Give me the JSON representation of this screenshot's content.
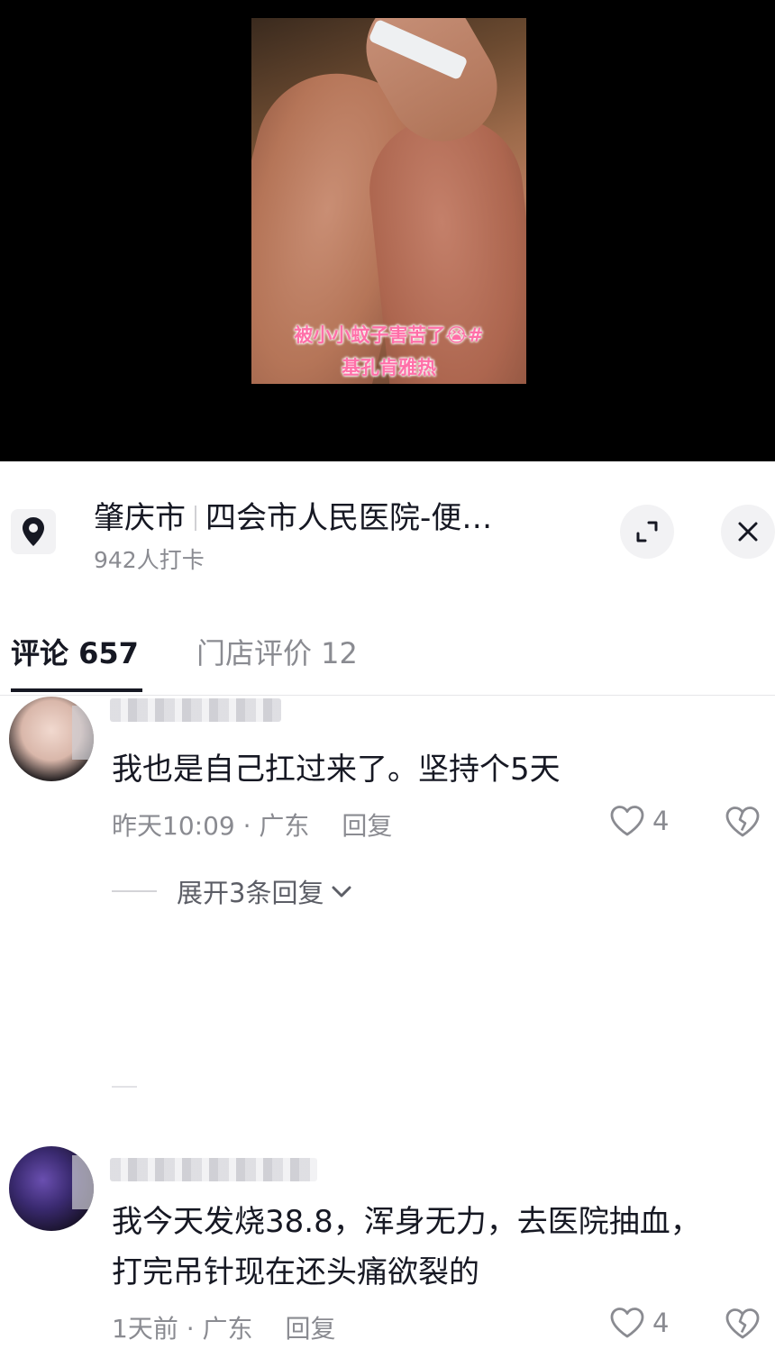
{
  "video": {
    "caption_line1": "被小小蚊子害苦了😭#",
    "caption_line2": "基孔肯雅热"
  },
  "location": {
    "city": "肇庆市",
    "place": "四会市人民医院-便…",
    "checkins": "942人打卡",
    "pin_icon": "location-pin-icon",
    "expand_icon": "expand-icon",
    "close_icon": "close-icon"
  },
  "tabs": {
    "comments": "评论 657",
    "reviews": "门店评价 12"
  },
  "comments": [
    {
      "text": "我也是自己扛过来了。坚持个5天",
      "time_location": "昨天10:09 · 广东",
      "reply": "回复",
      "likes": "4",
      "expand_replies": "展开3条回复"
    },
    {
      "text": "我今天发烧38.8，浑身无力，去医院抽血，打完吊针现在还头痛欲裂的",
      "time_location": "1天前 · 广东",
      "reply": "回复",
      "likes": "4"
    }
  ]
}
